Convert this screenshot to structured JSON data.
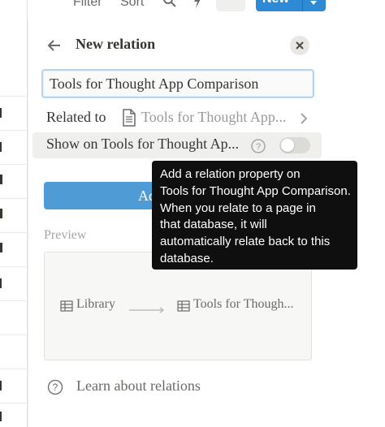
{
  "toolbar": {
    "filter_label": "Filter",
    "sort_label": "Sort",
    "new_label": "New",
    "icons": [
      "search-icon",
      "lightning-icon",
      "more-icon",
      "chevron-down-icon"
    ]
  },
  "panel": {
    "title": "New relation",
    "name_value": "Tools for Thought App Comparison",
    "related_label": "Related to",
    "related_value": "Tools for Thought App...",
    "show_label": "Show on Tools for Thought Ap...",
    "toggle_on": false,
    "add_button_label": "Add relation",
    "preview_label": "Preview",
    "preview_source": "Library",
    "preview_target": "Tools for Though...",
    "learn_label": "Learn about relations"
  },
  "tooltip": {
    "lines": [
      "Add a relation property on",
      "Tools for Thought App Comparison.",
      "When you relate to a page in",
      "that database, it will",
      "automatically relate back to this",
      "database."
    ]
  },
  "colors": {
    "accent": "#2f8ad6",
    "button": "#4f9bd5",
    "tooltip_bg": "#0f0f0f",
    "text": "#37352f",
    "muted": "#9b9a97"
  }
}
